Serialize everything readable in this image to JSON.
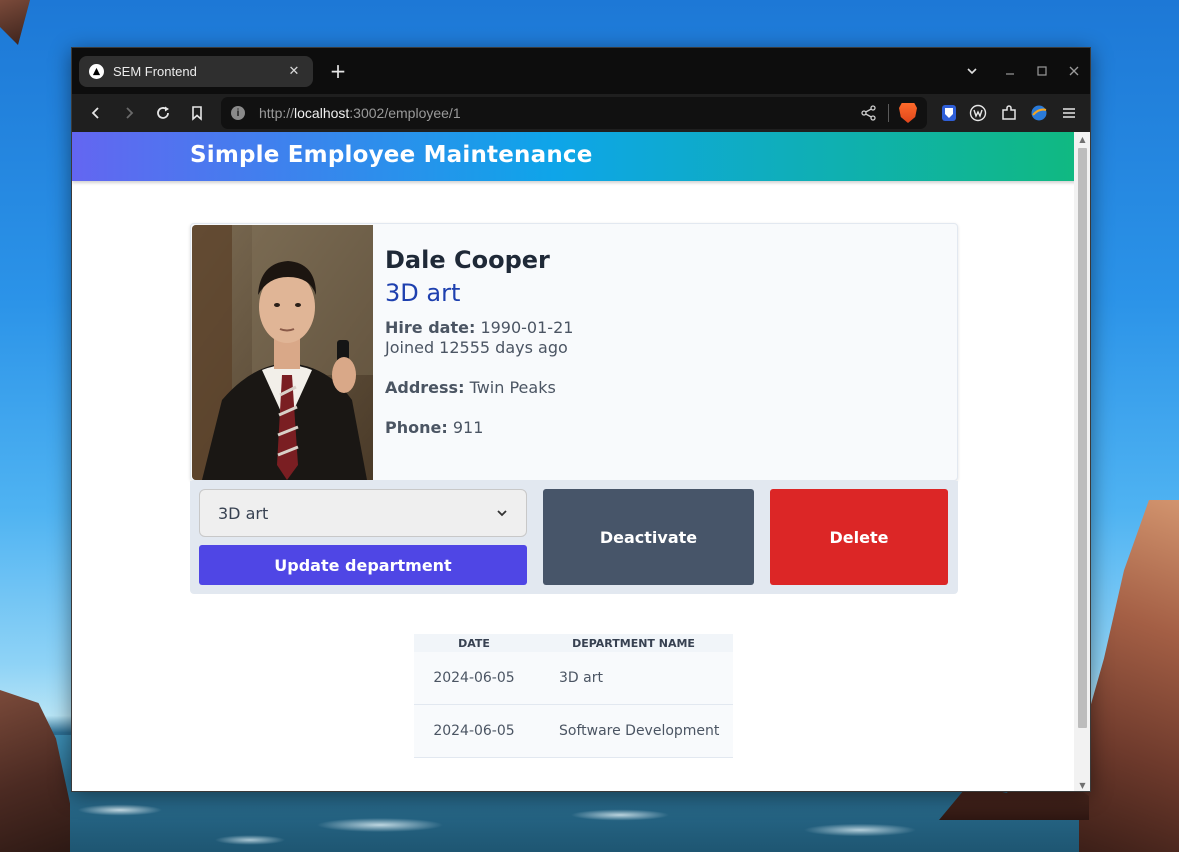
{
  "browser": {
    "tab_title": "SEM Frontend",
    "tab_close": "✕",
    "new_tab": "+",
    "url_scheme": "http://",
    "url_host": "localhost",
    "url_path": ":3002/employee/1"
  },
  "app": {
    "title": "Simple Employee Maintenance"
  },
  "employee": {
    "name": "Dale Cooper",
    "department": "3D art",
    "hire_label": "Hire date:",
    "hire_date": "1990-01-21",
    "joined_text": "Joined 12555 days ago",
    "address_label": "Address:",
    "address": "Twin Peaks",
    "phone_label": "Phone:",
    "phone": "911"
  },
  "actions": {
    "selected_department": "3D art",
    "update_label": "Update department",
    "deactivate_label": "Deactivate",
    "delete_label": "Delete"
  },
  "history": {
    "headers": [
      "DATE",
      "DEPARTMENT NAME"
    ],
    "rows": [
      {
        "date": "2024-06-05",
        "department": "3D art"
      },
      {
        "date": "2024-06-05",
        "department": "Software Development"
      }
    ]
  },
  "colors": {
    "header_gradient": [
      "#6366f1",
      "#0ea5e9",
      "#10b981"
    ],
    "update_button": "#4f46e5",
    "deactivate_button": "#475569",
    "delete_button": "#dc2626",
    "department_text": "#1e40af"
  },
  "icons": {
    "tab": "nextjs-favicon-icon",
    "nav": [
      "back-arrow-icon",
      "forward-arrow-icon",
      "reload-icon",
      "bookmark-icon"
    ],
    "url": [
      "site-info-icon",
      "share-icon",
      "brave-shields-icon"
    ],
    "extensions": [
      "bitwarden-icon",
      "wappalyzer-icon",
      "extensions-puzzle-icon",
      "brave-news-icon",
      "menu-icon"
    ],
    "window": [
      "tab-list-chevron-icon",
      "minimize-icon",
      "maximize-icon",
      "close-window-icon"
    ]
  }
}
